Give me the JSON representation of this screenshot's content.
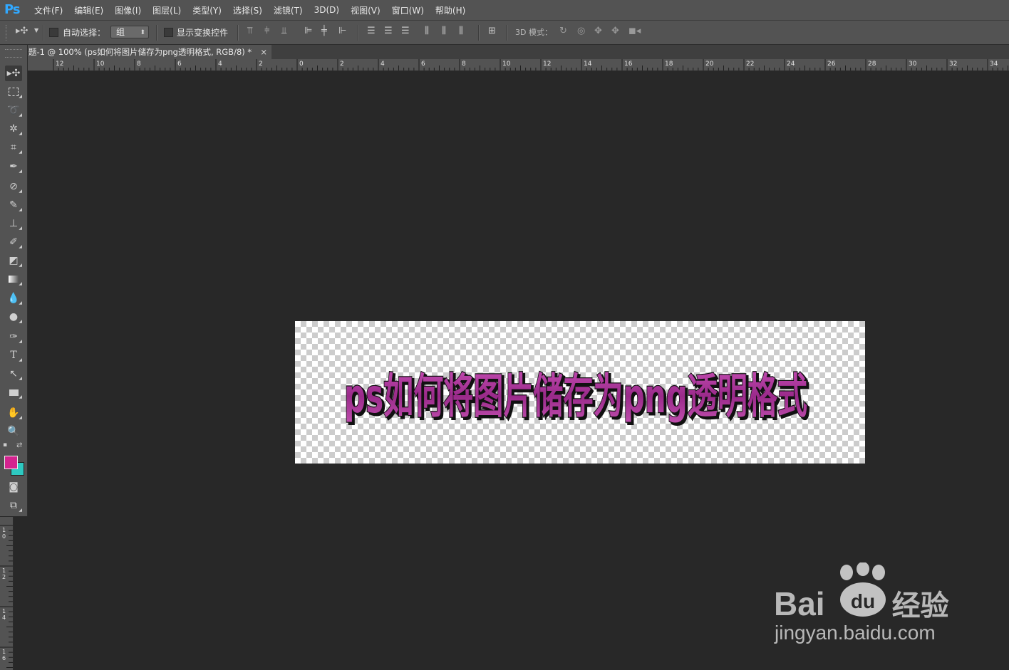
{
  "app": {
    "logo": "Ps"
  },
  "menu": [
    "文件(F)",
    "编辑(E)",
    "图像(I)",
    "图层(L)",
    "类型(Y)",
    "选择(S)",
    "滤镜(T)",
    "3D(D)",
    "视图(V)",
    "窗口(W)",
    "帮助(H)"
  ],
  "options": {
    "auto_select_label": "自动选择：",
    "auto_select_value": "组",
    "show_transform_label": "显示变换控件",
    "mode_3d_label": "3D 模式："
  },
  "document": {
    "tab_title": "题-1 @ 100% (ps如何将图片储存为png透明格式, RGB/8) *",
    "close_symbol": "×",
    "canvas_text": "ps如何将图片储存为png透明格式"
  },
  "ruler": {
    "h_labels": [
      "12",
      "10",
      "8",
      "6",
      "4",
      "2",
      "0",
      "2",
      "4",
      "6",
      "8",
      "10",
      "12",
      "14",
      "16",
      "18",
      "20",
      "22",
      "24",
      "26",
      "28",
      "30",
      "32",
      "34"
    ],
    "v_labels": [
      "10",
      "12",
      "14",
      "16"
    ]
  },
  "colors": {
    "foreground": "#d4238f",
    "background": "#2ec9c1",
    "text_fill": "#b0349a",
    "text_outline": "#111111"
  },
  "watermark": {
    "brand": "Bai",
    "brand2": "经验",
    "paw_text": "du",
    "url": "jingyan.baidu.com"
  }
}
